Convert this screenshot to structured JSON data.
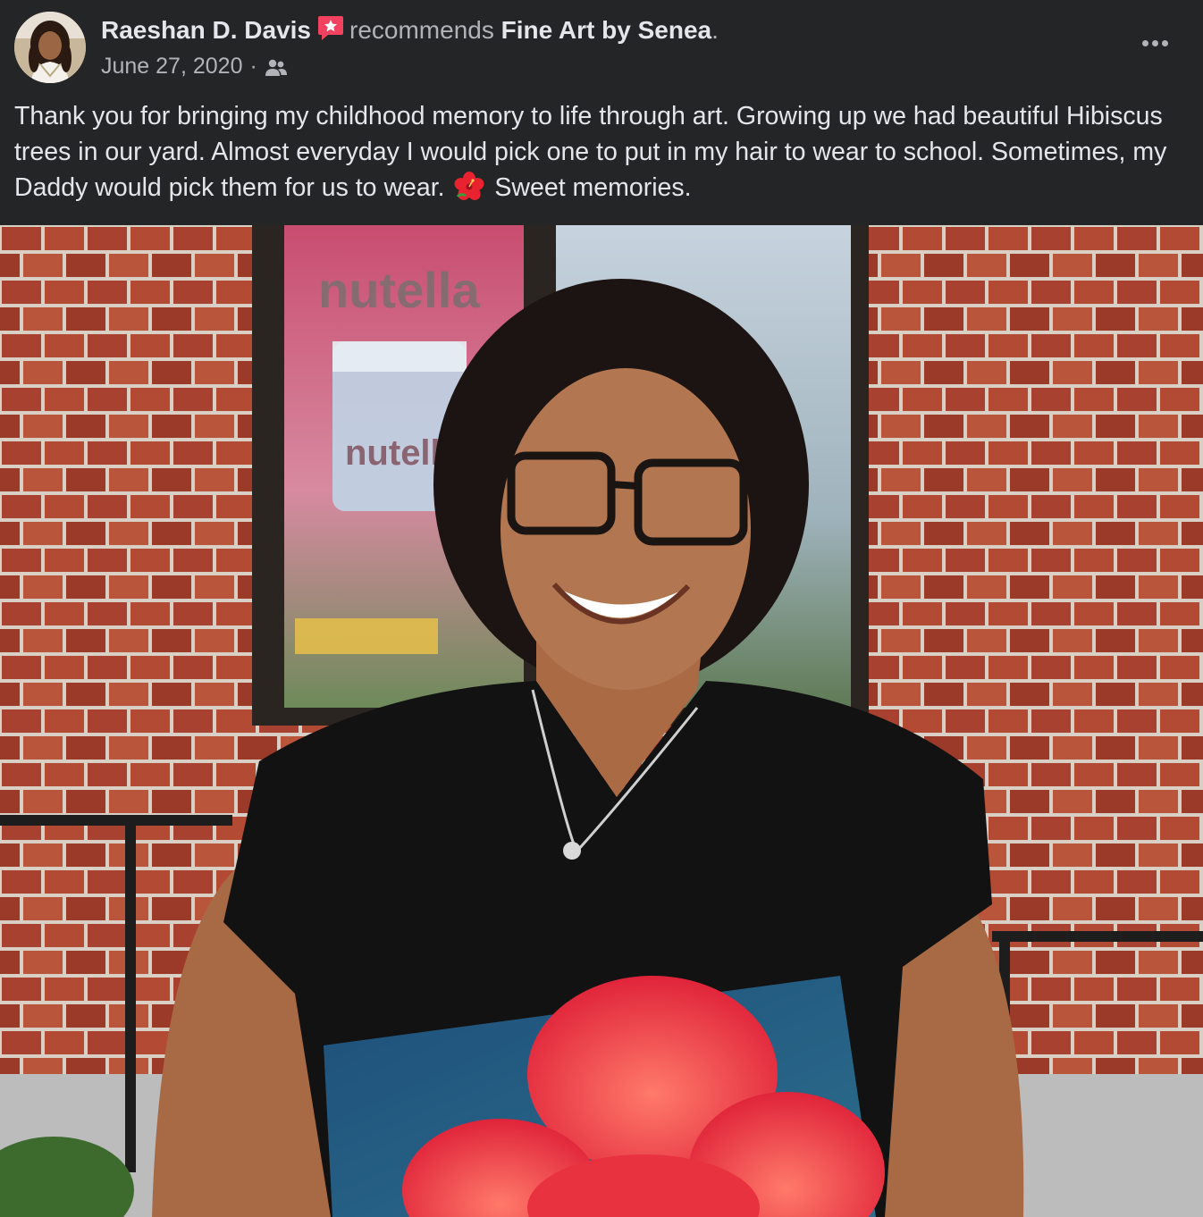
{
  "post": {
    "author": "Raeshan D. Davis",
    "action": "recommends",
    "page": "Fine Art by Senea",
    "period": ".",
    "date": "June 27, 2020",
    "separator": "·",
    "audience_icon": "friends-icon",
    "menu_icon": "more-options-icon",
    "text_part1": "Thank you for bringing my childhood memory to life through art. Growing up we had beautiful Hibiscus trees in our yard. Almost everyday I would pick one to put in my hair to wear to school. Sometimes, my Daddy would pick them for us to wear.",
    "emoji": "hibiscus-emoji",
    "text_part2": "Sweet memories."
  },
  "photo": {
    "window_sign_top": "nutella",
    "window_sign_jar": "nutella"
  },
  "colors": {
    "background": "#242526",
    "primary_text": "#e4e6eb",
    "secondary_text": "#b0b3b8",
    "recommend_badge": "#f3425f"
  }
}
